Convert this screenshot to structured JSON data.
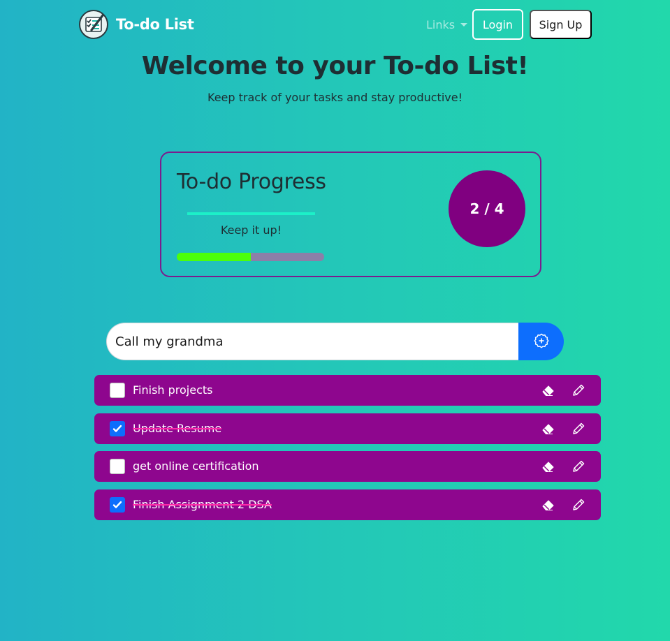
{
  "brand": {
    "name": "To-do List",
    "logo_icon": "checklist-icon"
  },
  "nav": {
    "links_label": "Links",
    "login_label": "Login",
    "signup_label": "Sign Up"
  },
  "hero": {
    "title": "Welcome to your To-do List!",
    "subtitle": "Keep track of your tasks and stay productive!"
  },
  "progress": {
    "title": "To-do Progress",
    "message": "Keep it up!",
    "completed": 2,
    "total": 4,
    "count_label": "2 / 4",
    "fraction": 0.5,
    "colors": {
      "fill": "#4cff0a",
      "track": "#8c7fa8",
      "circle": "#800080",
      "underline": "#1cf0c8"
    }
  },
  "add_form": {
    "input_value": "Call my grandma",
    "button_icon": "add-circle-icon"
  },
  "todos": [
    {
      "text": "Finish projects",
      "completed": false
    },
    {
      "text": "Update Resume",
      "completed": true
    },
    {
      "text": "get online certification",
      "completed": false
    },
    {
      "text": "Finish Assignment 2 DSA",
      "completed": true
    }
  ],
  "todo_actions": {
    "delete_icon": "eraser-icon",
    "edit_icon": "pencil-icon"
  },
  "colors": {
    "todo_bg": "#8e068e",
    "accent": "#0d6efd",
    "strike": "#ff2aa8"
  }
}
